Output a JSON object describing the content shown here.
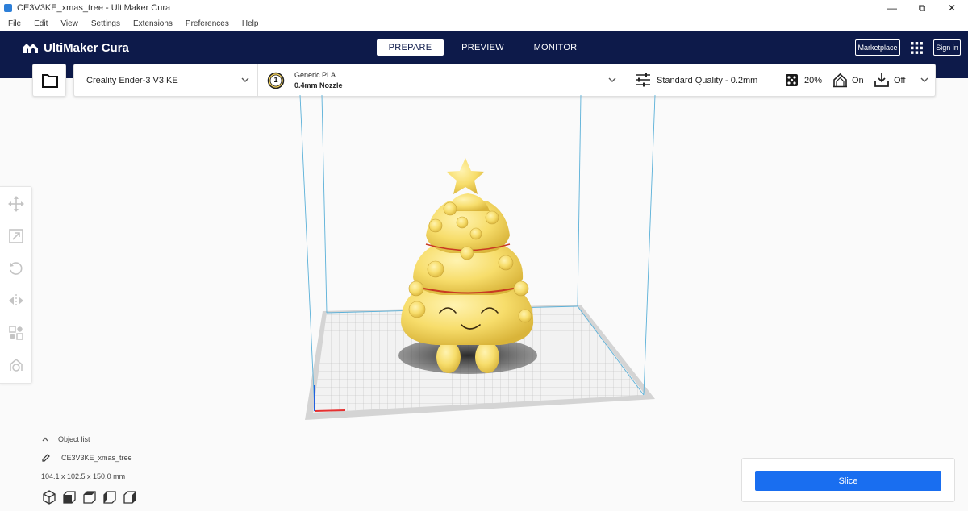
{
  "window": {
    "title": "CE3V3KE_xmas_tree - UltiMaker Cura",
    "minimize": "—",
    "restore": "⧉",
    "close": "✕"
  },
  "menu": [
    "File",
    "Edit",
    "View",
    "Settings",
    "Extensions",
    "Preferences",
    "Help"
  ],
  "header": {
    "logo": "UltiMaker Cura",
    "tabs": [
      {
        "label": "PREPARE",
        "active": true
      },
      {
        "label": "PREVIEW",
        "active": false
      },
      {
        "label": "MONITOR",
        "active": false
      }
    ],
    "marketplace": "Marketplace",
    "sign_in": "Sign in"
  },
  "toolbar": {
    "printer": "Creality Ender-3 V3 KE",
    "extruder_number": "1",
    "material": "Generic PLA",
    "nozzle": "0.4mm Nozzle",
    "quality": "Standard Quality - 0.2mm",
    "infill": "20%",
    "support": "On",
    "adhesion": "Off"
  },
  "object_list": {
    "toggle_label": "Object list",
    "object_name": "CE3V3KE_xmas_tree",
    "dimensions": "104.1 x 102.5 x 150.0 mm"
  },
  "slice": {
    "button_label": "Slice"
  },
  "colors": {
    "header_bg": "#0d1a4a",
    "accent_blue": "#196ef0",
    "model_yellow": "#f7dd6b",
    "plate_grid": "#b8b8b8"
  },
  "icons": {
    "logo": "ultimaker-logo-icon",
    "open_file": "folder-icon",
    "apps": "apps-grid-icon",
    "print_settings": "sliders-icon",
    "infill": "infill-icon",
    "support": "support-icon",
    "adhesion": "adhesion-icon",
    "move": "move-icon",
    "scale": "scale-icon",
    "rotate": "rotate-icon",
    "mirror": "mirror-icon",
    "per_model": "per-model-settings-icon",
    "support_blocker": "support-blocker-icon"
  }
}
